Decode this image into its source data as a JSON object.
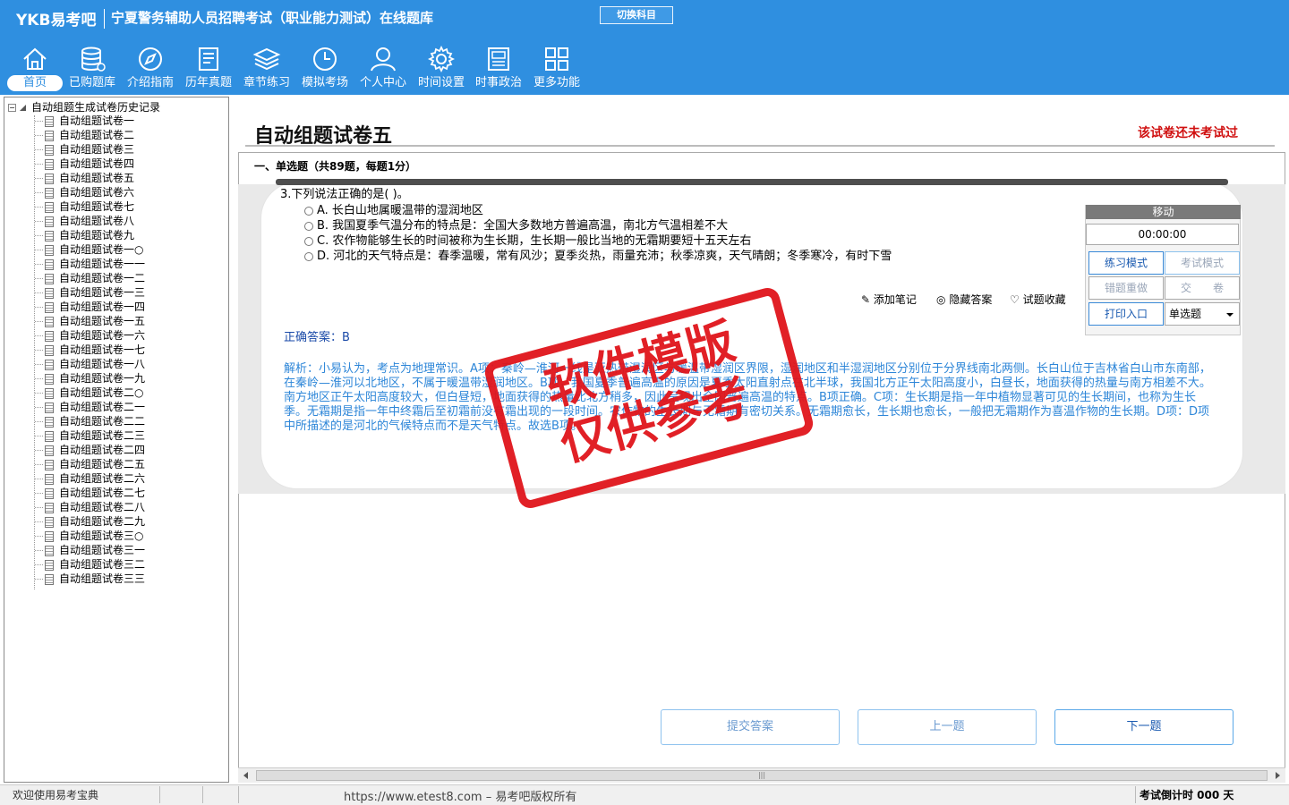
{
  "header": {
    "logo": "YKB易考吧",
    "title": "宁夏警务辅助人员招聘考试（职业能力测试）在线题库",
    "switch_label": "切换科目"
  },
  "nav": [
    {
      "label": "首页",
      "icon": "home-icon"
    },
    {
      "label": "已购题库",
      "icon": "database-icon"
    },
    {
      "label": "介绍指南",
      "icon": "compass-icon"
    },
    {
      "label": "历年真题",
      "icon": "list-doc-icon"
    },
    {
      "label": "章节练习",
      "icon": "layers-icon"
    },
    {
      "label": "模拟考场",
      "icon": "clock-icon"
    },
    {
      "label": "个人中心",
      "icon": "user-icon"
    },
    {
      "label": "时间设置",
      "icon": "gear-icon"
    },
    {
      "label": "时事政治",
      "icon": "news-icon"
    },
    {
      "label": "更多功能",
      "icon": "grid-icon"
    }
  ],
  "tree": {
    "root": "自动组题生成试卷历史记录",
    "items": [
      "自动组题试卷一",
      "自动组题试卷二",
      "自动组题试卷三",
      "自动组题试卷四",
      "自动组题试卷五",
      "自动组题试卷六",
      "自动组题试卷七",
      "自动组题试卷八",
      "自动组题试卷九",
      "自动组题试卷一○",
      "自动组题试卷一一",
      "自动组题试卷一二",
      "自动组题试卷一三",
      "自动组题试卷一四",
      "自动组题试卷一五",
      "自动组题试卷一六",
      "自动组题试卷一七",
      "自动组题试卷一八",
      "自动组题试卷一九",
      "自动组题试卷二○",
      "自动组题试卷二一",
      "自动组题试卷二二",
      "自动组题试卷二三",
      "自动组题试卷二四",
      "自动组题试卷二五",
      "自动组题试卷二六",
      "自动组题试卷二七",
      "自动组题试卷二八",
      "自动组题试卷二九",
      "自动组题试卷三○",
      "自动组题试卷三一",
      "自动组题试卷三二",
      "自动组题试卷三三"
    ]
  },
  "paper": {
    "title": "自动组题试卷五",
    "status": "该试卷还未考试过",
    "section": "一、单选题（共89题，每题1分）"
  },
  "question": {
    "text": "3.下列说法正确的是( )。",
    "options": [
      "A. 长白山地属暖温带的湿润地区",
      "B. 我国夏季气温分布的特点是：全国大多数地方普遍高温，南北方气温相差不大",
      "C. 农作物能够生长的时间被称为生长期，生长期一般比当地的无霜期要短十五天左右",
      "D. 河北的天气特点是：春季温暖，常有风沙；夏季炎热，雨量充沛；秋季凉爽，天气晴朗；冬季寒冷，有时下雪"
    ],
    "tools": [
      "添加笔记",
      "隐藏答案",
      "试题收藏"
    ],
    "answer": "正确答案：B",
    "analysis": "解析：小易认为，考点为地理常识。A项：秦岭—淮河一线是亚热带湿润区与暖温带湿润区界限，湿润地区和半湿润地区分别位于分界线南北两侧。长白山位于吉林省白山市东南部，在秦岭—淮河以北地区，不属于暖温带湿润地区。B项，我国夏季普遍高温的原因是夏季太阳直射点在北半球，我国北方正午太阳高度小，白昼长，地面获得的热量与南方相差不大。南方地区正午太阳高度较大，但白昼短，地面获得的热量比北方稍多，因此呈现出全国普遍高温的特点。B项正确。C项：生长期是指一年中植物显著可见的生长期间，也称为生长季。无霜期是指一年中终霜后至初霜前没有霜出现的一段时间。农作物的生长期与无霜期有密切关系。无霜期愈长，生长期也愈长，一般把无霜期作为喜温作物的生长期。D项：D项中所描述的是河北的气候特点而不是天气特点。故选B项。"
  },
  "panel": {
    "move_label": "移动",
    "timer": "00:00:00",
    "practice_mode": "练习模式",
    "exam_mode": "考试模式",
    "wrong_redo": "错题重做",
    "submit_paper": "交　　卷",
    "print": "打印入口",
    "qtype": "单选题"
  },
  "buttons": {
    "submit": "提交答案",
    "prev": "上一题",
    "next": "下一题"
  },
  "stamp": {
    "line1": "软件模版",
    "line2": "仅供参考"
  },
  "statusbar": {
    "welcome": "欢迎使用易考宝典",
    "copyright": "https://www.etest8.com – 易考吧版权所有",
    "countdown": "考试倒计时 000 天"
  },
  "colors": {
    "header": "#2f8fe0",
    "status_red": "#d01010",
    "answer_blue": "#1a4aa8",
    "analysis_blue": "#2d86d8",
    "stamp_red": "#e0151b"
  }
}
